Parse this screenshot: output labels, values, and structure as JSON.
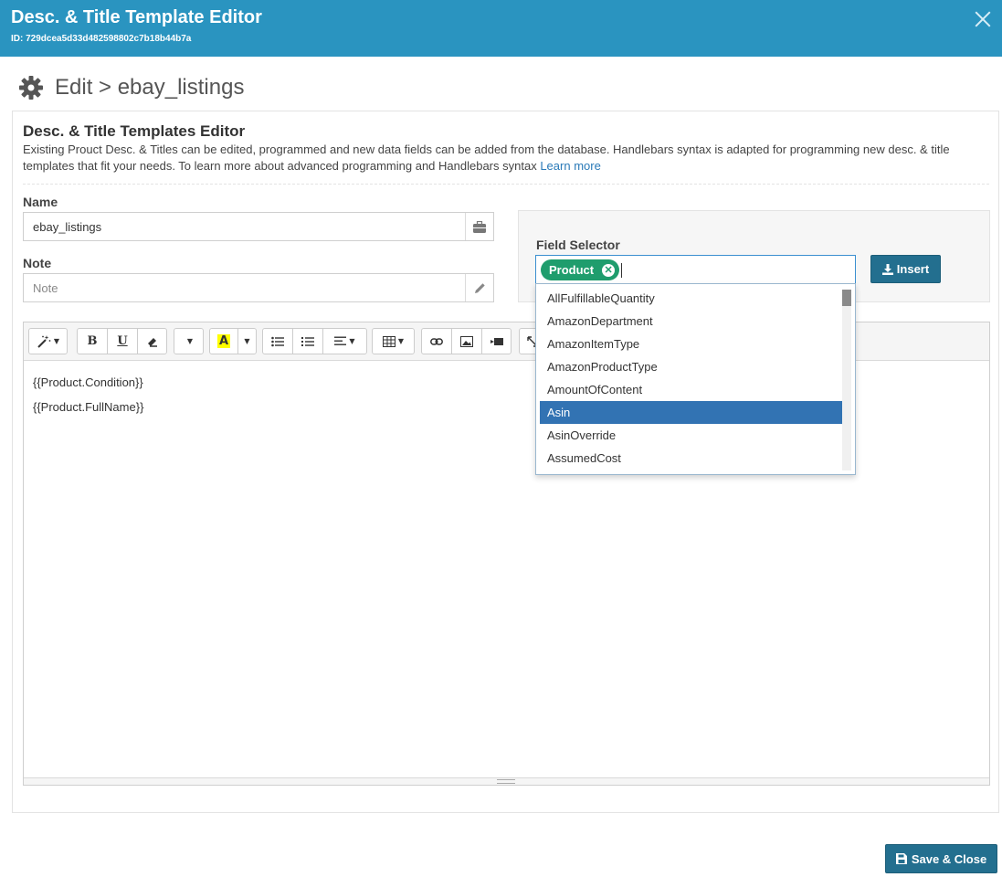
{
  "window": {
    "title": "Desc. & Title Template Editor",
    "id_text": "ID: 729dcea5d33d482598802c7b18b44b7a"
  },
  "page": {
    "heading": "Edit > ebay_listings"
  },
  "panel": {
    "title": "Desc. & Title Templates Editor",
    "description": "Existing Prouct Desc. & Titles can be edited, programmed and new data fields can be added from the database. Handlebars syntax is adapted for programming new desc. & title templates that fit your needs. To learn more about advanced programming and Handlebars syntax",
    "learn_more": "Learn more"
  },
  "form": {
    "name_label": "Name",
    "name_value": "ebay_listings",
    "note_label": "Note",
    "note_placeholder": "Note"
  },
  "field_selector": {
    "label": "Field Selector",
    "tag": "Product",
    "insert_label": "Insert",
    "options": [
      "AllFulfillableQuantity",
      "AmazonDepartment",
      "AmazonItemType",
      "AmazonProductType",
      "AmountOfContent",
      "Asin",
      "AsinOverride",
      "AssumedCost"
    ],
    "selected_option": "Asin"
  },
  "editor": {
    "lines": [
      "{{Product.Condition}}",
      "{{Product.FullName}}"
    ]
  },
  "footer": {
    "save_label": "Save & Close"
  },
  "colors": {
    "header": "#2a94c0",
    "primary_button": "#236f8f",
    "tag": "#1f9d6d",
    "selected_option": "#3273b3"
  }
}
